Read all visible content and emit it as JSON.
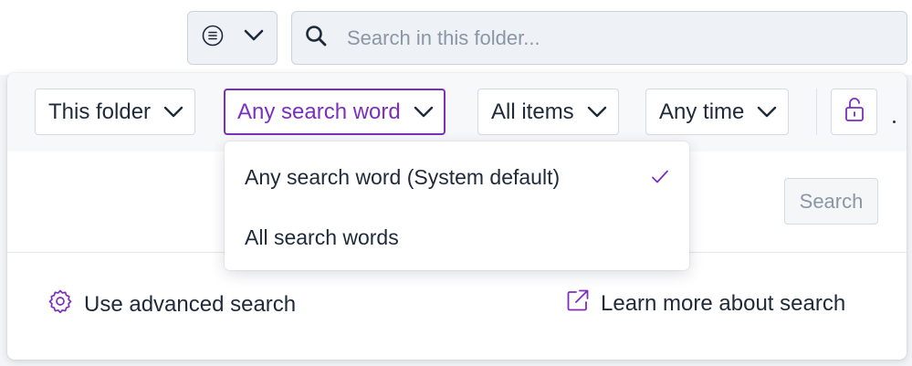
{
  "toolbar": {
    "view_button_icon": "list-circle-icon",
    "view_chevron_icon": "chevron-down-icon",
    "search_icon": "search-icon",
    "search_placeholder": "Search in this folder..."
  },
  "filters": {
    "scope": {
      "label": "This folder"
    },
    "match": {
      "label": "Any search word",
      "active": true
    },
    "items": {
      "label": "All items"
    },
    "time": {
      "label": "Any time"
    },
    "lock_icon": "unlock-icon"
  },
  "menu": {
    "items": [
      {
        "label": "Any search word (System default)",
        "selected": true
      },
      {
        "label": "All search words",
        "selected": false
      }
    ],
    "check_icon": "checkmark-icon"
  },
  "actions": {
    "search_label": "Search"
  },
  "footer": {
    "advanced_label": "Use advanced search",
    "advanced_icon": "gear-icon",
    "learn_label": "Learn more about search",
    "learn_icon": "external-link-icon"
  },
  "colors": {
    "accent": "#7b2fbf",
    "text": "#1e2a3a",
    "muted": "#8b96a5",
    "border": "#d3dae2"
  }
}
